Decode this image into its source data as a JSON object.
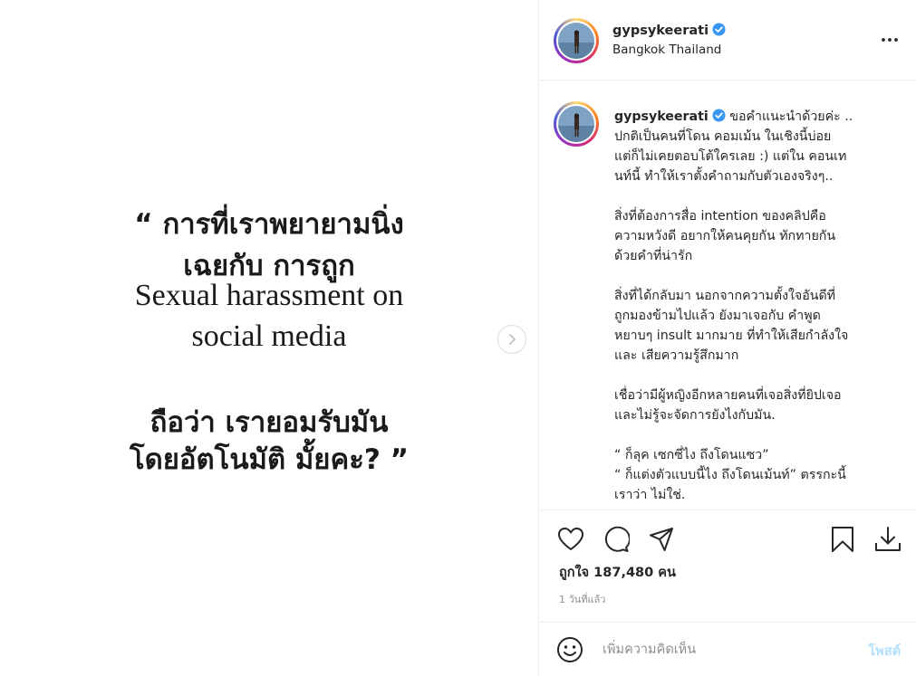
{
  "media": {
    "quote_lines": [
      "“ การที่เราพยายามนิ่ง",
      "เฉยกับ การถูก",
      "Sexual harassment on",
      "social media",
      "ถือว่า เรายอมรับมัน",
      "โดยอัตโนมัติ มั้ยคะ? ”"
    ],
    "next_icon": "chevron-right-icon"
  },
  "header": {
    "username": "gypsykeerati",
    "location": "Bangkok Thailand",
    "verified_icon": "verified-badge-icon",
    "more_icon": "more-options-icon"
  },
  "caption": {
    "username": "gypsykeerati",
    "first_line_text": "ขอคำแนะนำด้วยค่ะ ..",
    "lines_block1": [
      "ปกติเป็นคนที่โดน คอมเม้น ในเชิงนี้บ่อย",
      "แต่ก็ไม่เคยตอบโต้ใครเลย :) แต่ใน คอนเท",
      "นท์นี้ ทำให้เราตั้งคำถามกับตัวเองจริงๆ.."
    ],
    "lines_block2": [
      "สิ่งที่ต้องการสื่อ intention ของคลิปคือ",
      "ความหวังดี อยากให้คนคุยกัน ทักทายกัน",
      "ด้วยคำที่น่ารัก"
    ],
    "lines_block3": [
      "สิ่งที่ได้กลับมา นอกจากความตั้งใจอันดีที่",
      "ถูกมองข้ามไปแล้ว ยังมาเจอกับ คำพูด",
      "หยาบๆ insult มากมาย ที่ทำให้เสียกำลังใจ",
      "และ เสียความรู้สึกมาก"
    ],
    "lines_block4": [
      "เชื่อว่ามีผู้หญิงอีกหลายคนที่เจอสิ่งที่ยิปเจอ",
      "และไม่รู้จะจัดการยังไงกับมัน."
    ],
    "lines_block5": [
      "“ ก็ลุค เซกซี่ไง ถึงโดนแซว”",
      "“ ก็แต่งตัวแบบนี้ไง ถึงโดนเม้นท์” ตรรกะนี้",
      "เราว่า ไม่ใช่."
    ]
  },
  "actions": {
    "like_icon": "heart-icon",
    "comment_icon": "comment-icon",
    "share_icon": "share-icon",
    "save_icon": "bookmark-icon",
    "download_icon": "download-icon",
    "likes_text": "ถูกใจ 187,480 คน",
    "time_text": "1 วันที่แล้ว"
  },
  "comment": {
    "emoji_icon": "emoji-icon",
    "placeholder": "เพิ่มความคิดเห็น",
    "post_label": "โพสต์"
  },
  "colors": {
    "accent_blue": "#0095f6",
    "post_disabled": "#b2dffc",
    "verified": "#3897f0"
  }
}
